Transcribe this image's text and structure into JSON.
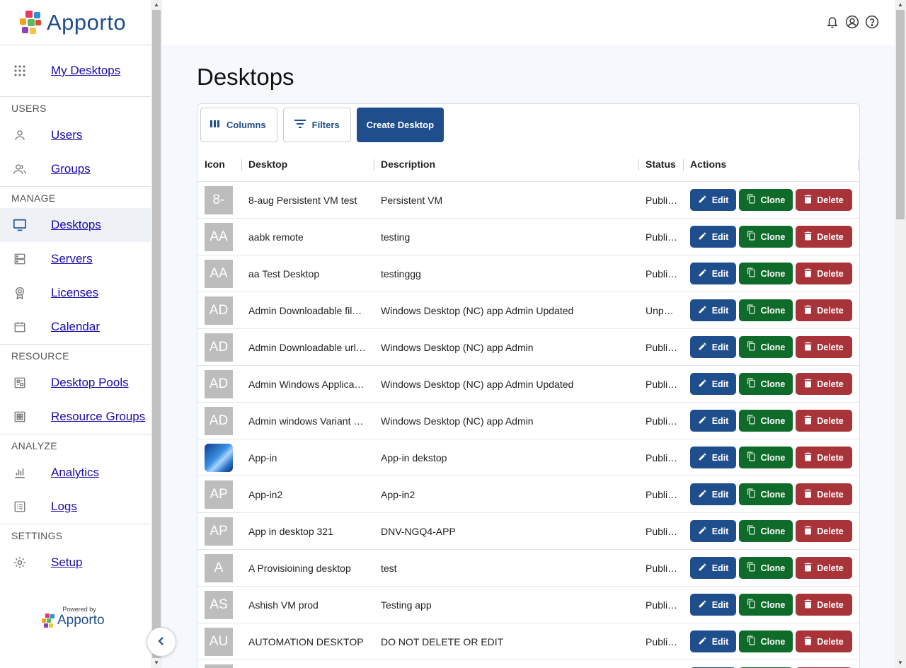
{
  "brand": {
    "name": "Apporto",
    "powered_by": "Powered by",
    "powered_name": "Apporto"
  },
  "nav": {
    "top": {
      "label": "My Desktops",
      "icon": "grid-dots-icon"
    },
    "sections": [
      {
        "label": "USERS",
        "items": [
          {
            "label": "Users",
            "icon": "person-icon"
          },
          {
            "label": "Groups",
            "icon": "people-icon"
          }
        ]
      },
      {
        "label": "MANAGE",
        "items": [
          {
            "label": "Desktops",
            "icon": "monitor-icon",
            "active": true
          },
          {
            "label": "Servers",
            "icon": "server-icon"
          },
          {
            "label": "Licenses",
            "icon": "badge-icon"
          },
          {
            "label": "Calendar",
            "icon": "calendar-icon"
          }
        ]
      },
      {
        "label": "RESOURCE",
        "items": [
          {
            "label": "Desktop Pools",
            "icon": "desktop-pool-icon"
          },
          {
            "label": "Resource Groups",
            "icon": "resource-grid-icon"
          }
        ]
      },
      {
        "label": "ANALYZE",
        "items": [
          {
            "label": "Analytics",
            "icon": "bar-chart-icon"
          },
          {
            "label": "Logs",
            "icon": "list-icon"
          }
        ]
      },
      {
        "label": "SETTINGS",
        "items": [
          {
            "label": "Setup",
            "icon": "gear-icon"
          }
        ]
      }
    ]
  },
  "page": {
    "title": "Desktops"
  },
  "toolbar": {
    "columns_label": "Columns",
    "filters_label": "Filters",
    "create_label": "Create Desktop"
  },
  "table": {
    "columns": [
      "Icon",
      "Desktop",
      "Description",
      "Status",
      "Actions"
    ],
    "actions": {
      "edit": "Edit",
      "clone": "Clone",
      "delete": "Delete"
    },
    "rows": [
      {
        "initials": "8-",
        "desktop": "8-aug Persistent VM test",
        "description": "Persistent VM",
        "status": "Publi…"
      },
      {
        "initials": "AA",
        "desktop": "aabk remote",
        "description": "testing",
        "status": "Publi…"
      },
      {
        "initials": "AA",
        "desktop": "aa Test Desktop",
        "description": "testinggg",
        "status": "Publi…"
      },
      {
        "initials": "AD",
        "desktop": "Admin Downloadable fil…",
        "description": "Windows Desktop (NC) app Admin Updated",
        "status": "Unp…"
      },
      {
        "initials": "AD",
        "desktop": "Admin Downloadable url…",
        "description": "Windows Desktop (NC) app Admin",
        "status": "Publi…"
      },
      {
        "initials": "AD",
        "desktop": "Admin Windows Applica…",
        "description": "Windows Desktop (NC) app Admin Updated",
        "status": "Publi…"
      },
      {
        "initials": "AD",
        "desktop": "Admin windows Variant …",
        "description": "Windows Desktop (NC) app Admin",
        "status": "Publi…"
      },
      {
        "initials": "",
        "image": true,
        "desktop": "App-in",
        "description": "App-in dekstop",
        "status": "Publi…"
      },
      {
        "initials": "AP",
        "desktop": "App-in2",
        "description": "App-in2",
        "status": "Publi…"
      },
      {
        "initials": "AP",
        "desktop": "App in desktop 321",
        "description": "DNV-NGQ4-APP",
        "status": "Publi…"
      },
      {
        "initials": "A",
        "desktop": "A Provisioining desktop",
        "description": "test",
        "status": "Publi…"
      },
      {
        "initials": "AS",
        "desktop": "Ashish VM prod",
        "description": "Testing app",
        "status": "Publi…"
      },
      {
        "initials": "AU",
        "desktop": "AUTOMATION DESKTOP",
        "description": "DO NOT DELETE OR EDIT",
        "status": "Publi…"
      }
    ]
  },
  "colors": {
    "primary": "#1f4e8c",
    "clone": "#0f6b2a",
    "delete": "#a8343a",
    "link": "#1a0dab"
  }
}
